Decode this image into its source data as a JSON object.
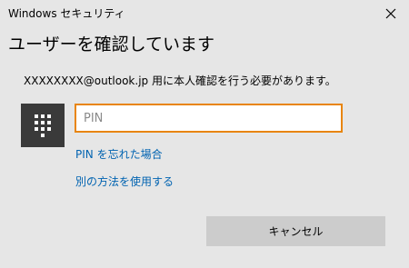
{
  "window": {
    "app_title": "Windows セキュリティ",
    "close_icon": "close-icon"
  },
  "dialog": {
    "heading": "ユーザーを確認しています",
    "message": "XXXXXXXX@outlook.jp 用に本人確認を行う必要があります。",
    "keypad_icon": "keypad-icon",
    "pin_placeholder": "PIN",
    "pin_value": "",
    "focus_color": "#e8850c",
    "links": {
      "forgot_pin": "PIN を忘れた場合",
      "other_method": "別の方法を使用する"
    },
    "link_color": "#0063b1",
    "cancel_label": "キャンセル"
  }
}
